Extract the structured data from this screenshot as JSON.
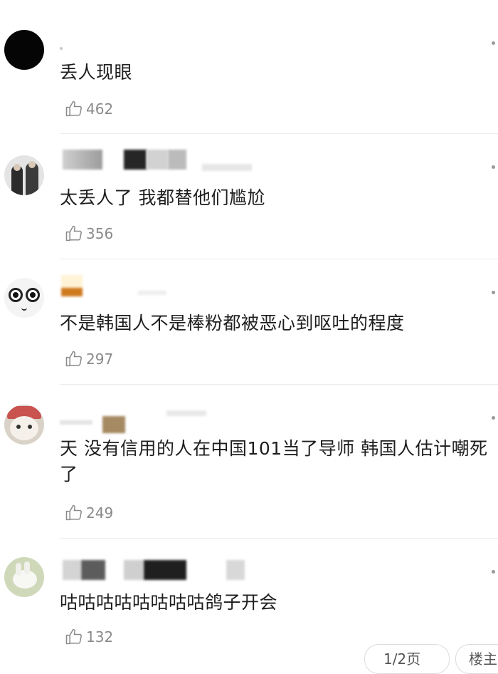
{
  "comments": [
    {
      "text": "丢人现眼",
      "likes": "462"
    },
    {
      "text": "太丢人了  我都替他们尴尬",
      "likes": "356"
    },
    {
      "text": "不是韩国人不是棒粉都被恶心到呕吐的程度",
      "likes": "297"
    },
    {
      "text": "天 没有信用的人在中国101当了导师 韩国人估计嘲死了",
      "likes": "249"
    },
    {
      "text": "咕咕咕咕咕咕咕咕鸽子开会",
      "likes": "132"
    }
  ],
  "footer": {
    "page_label": "1/2页",
    "sort_label": "楼主"
  },
  "icons": {
    "like": "thumbs-up-icon",
    "menu": "more-dot-icon"
  },
  "colors": {
    "text": "#1e1e1e",
    "meta": "#8a8a8a",
    "divider": "#ececec"
  }
}
